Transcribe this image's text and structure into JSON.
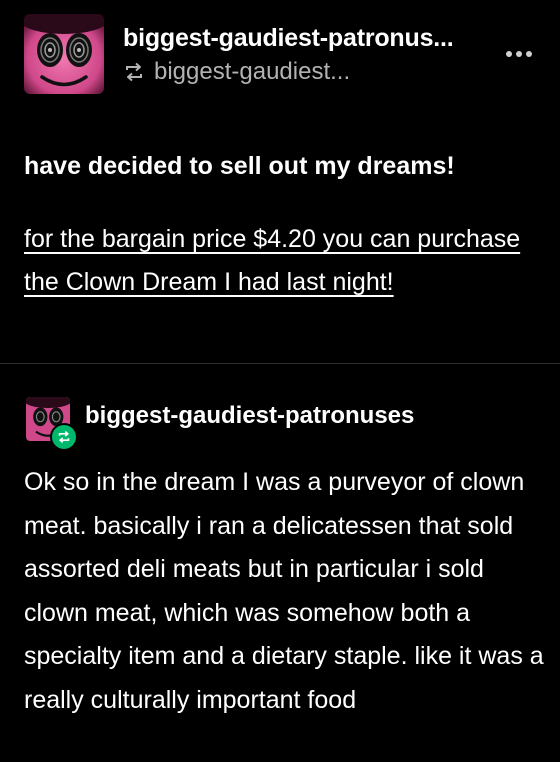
{
  "post": {
    "blog_name": "biggest-gaudiest-patronus...",
    "reblogged_from": "biggest-gaudiest...",
    "more_icon": "more-horizontal-icon",
    "reblog_icon": "reblog-icon",
    "avatar_description": "clown-face-avatar"
  },
  "content": {
    "headline": "have decided to sell out my dreams!",
    "link_text": "for the bargain price $4.20 you can purchase the Clown Dream I had last night!"
  },
  "trail": {
    "blog_name": "biggest-gaudiest-patronuses",
    "badge_color": "#00b86b",
    "body": "Ok so in the dream I was a purveyor of clown meat. basically i ran a delicatessen that sold assorted deli meats but in particular i sold clown meat, which was somehow both a specialty item and a dietary staple. like it was a really culturally important food"
  },
  "colors": {
    "background": "#000000",
    "text": "#ffffff",
    "muted": "#b3b3b3",
    "avatar_pink": "#e0609a"
  }
}
